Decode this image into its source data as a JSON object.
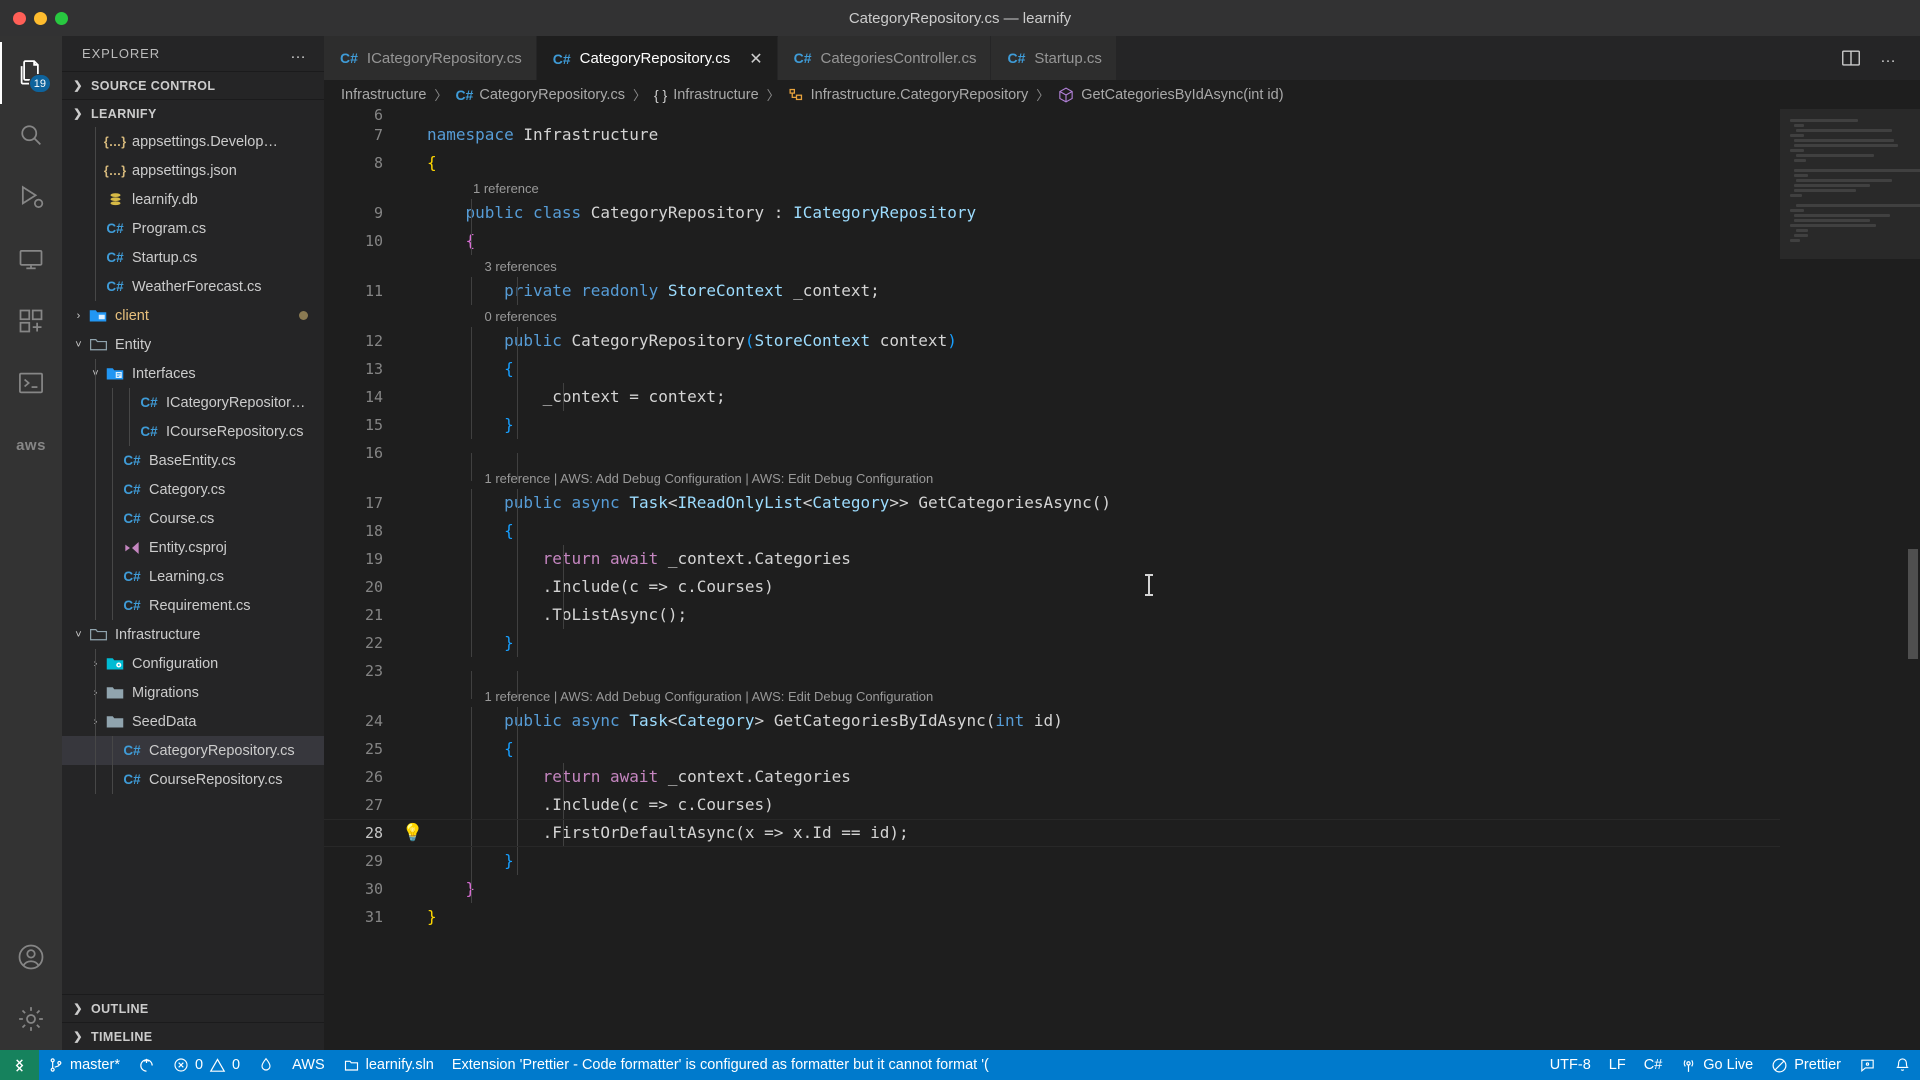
{
  "window": {
    "title": "CategoryRepository.cs — learnify",
    "traffic_lights": [
      "close",
      "minimize",
      "maximize"
    ]
  },
  "activity_bar": {
    "items": [
      {
        "name": "explorer",
        "icon": "files-icon",
        "badge": "19",
        "active": true
      },
      {
        "name": "search",
        "icon": "search-icon",
        "badge": "",
        "active": false
      },
      {
        "name": "run-and-debug",
        "icon": "run-debug-icon",
        "badge": "",
        "active": false
      },
      {
        "name": "remote-explorer",
        "icon": "remote-explorer-icon",
        "badge": "",
        "active": false
      },
      {
        "name": "extensions",
        "icon": "extensions-icon",
        "badge": "",
        "active": false
      },
      {
        "name": "terminal",
        "icon": "terminal-icon",
        "badge": "",
        "active": false
      },
      {
        "name": "aws-toolkit",
        "icon": "aws-icon",
        "badge": "",
        "active": false
      }
    ],
    "bottom_items": [
      {
        "name": "accounts",
        "icon": "account-icon"
      },
      {
        "name": "manage",
        "icon": "gear-icon"
      }
    ],
    "aws_label": "aws"
  },
  "sidebar": {
    "title": "EXPLORER",
    "more_actions": "…",
    "sections": [
      {
        "label": "SOURCE CONTROL",
        "expanded": false
      },
      {
        "label": "LEARNIFY",
        "expanded": true
      }
    ],
    "bottom_sections": [
      {
        "label": "OUTLINE",
        "expanded": false
      },
      {
        "label": "TIMELINE",
        "expanded": false
      }
    ],
    "tree": [
      {
        "label": "appsettings.Develop…",
        "icon": "json-icon",
        "indent": 2,
        "twist": "",
        "selected": false,
        "modified": false
      },
      {
        "label": "appsettings.json",
        "icon": "json-icon",
        "indent": 2,
        "twist": "",
        "selected": false,
        "modified": false
      },
      {
        "label": "learnify.db",
        "icon": "database-icon",
        "indent": 2,
        "twist": "",
        "selected": false,
        "modified": false
      },
      {
        "label": "Program.cs",
        "icon": "csharp-icon",
        "indent": 2,
        "twist": "",
        "selected": false,
        "modified": false
      },
      {
        "label": "Startup.cs",
        "icon": "csharp-icon",
        "indent": 2,
        "twist": "",
        "selected": false,
        "modified": false
      },
      {
        "label": "WeatherForecast.cs",
        "icon": "csharp-icon",
        "indent": 2,
        "twist": "",
        "selected": false,
        "modified": false
      },
      {
        "label": "client",
        "icon": "folder-client-icon",
        "indent": 1,
        "twist": "collapsed",
        "selected": false,
        "modified": true
      },
      {
        "label": "Entity",
        "icon": "folder-open-icon",
        "indent": 1,
        "twist": "expanded",
        "selected": false,
        "modified": false
      },
      {
        "label": "Interfaces",
        "icon": "folder-interfaces-icon",
        "indent": 2,
        "twist": "expanded",
        "selected": false,
        "modified": false
      },
      {
        "label": "ICategoryRepositor…",
        "icon": "csharp-icon",
        "indent": 4,
        "twist": "",
        "selected": false,
        "modified": false
      },
      {
        "label": "ICourseRepository.cs",
        "icon": "csharp-icon",
        "indent": 4,
        "twist": "",
        "selected": false,
        "modified": false
      },
      {
        "label": "BaseEntity.cs",
        "icon": "csharp-icon",
        "indent": 3,
        "twist": "",
        "selected": false,
        "modified": false
      },
      {
        "label": "Category.cs",
        "icon": "csharp-icon",
        "indent": 3,
        "twist": "",
        "selected": false,
        "modified": false
      },
      {
        "label": "Course.cs",
        "icon": "csharp-icon",
        "indent": 3,
        "twist": "",
        "selected": false,
        "modified": false
      },
      {
        "label": "Entity.csproj",
        "icon": "csproj-icon",
        "indent": 3,
        "twist": "",
        "selected": false,
        "modified": false
      },
      {
        "label": "Learning.cs",
        "icon": "csharp-icon",
        "indent": 3,
        "twist": "",
        "selected": false,
        "modified": false
      },
      {
        "label": "Requirement.cs",
        "icon": "csharp-icon",
        "indent": 3,
        "twist": "",
        "selected": false,
        "modified": false
      },
      {
        "label": "Infrastructure",
        "icon": "folder-open-icon",
        "indent": 1,
        "twist": "expanded",
        "selected": false,
        "modified": false
      },
      {
        "label": "Configuration",
        "icon": "folder-config-icon",
        "indent": 2,
        "twist": "collapsed",
        "selected": false,
        "modified": false
      },
      {
        "label": "Migrations",
        "icon": "folder-icon",
        "indent": 2,
        "twist": "collapsed",
        "selected": false,
        "modified": false
      },
      {
        "label": "SeedData",
        "icon": "folder-icon",
        "indent": 2,
        "twist": "collapsed",
        "selected": false,
        "modified": false
      },
      {
        "label": "CategoryRepository.cs",
        "icon": "csharp-icon",
        "indent": 3,
        "twist": "",
        "selected": true,
        "modified": false
      },
      {
        "label": "CourseRepository.cs",
        "icon": "csharp-icon",
        "indent": 3,
        "twist": "",
        "selected": false,
        "modified": false
      }
    ]
  },
  "tabs": [
    {
      "label": "ICategoryRepository.cs",
      "icon": "csharp-icon",
      "active": false,
      "closable": false
    },
    {
      "label": "CategoryRepository.cs",
      "icon": "csharp-icon",
      "active": true,
      "closable": true,
      "close_label": "✕"
    },
    {
      "label": "CategoriesController.cs",
      "icon": "csharp-icon",
      "active": false,
      "closable": false
    },
    {
      "label": "Startup.cs",
      "icon": "csharp-icon",
      "active": false,
      "closable": false
    }
  ],
  "editor_actions": [
    {
      "name": "split-editor",
      "icon": "split-editor-icon"
    },
    {
      "name": "more-actions",
      "icon": "ellipsis-icon",
      "label": "…"
    }
  ],
  "breadcrumbs": [
    {
      "label": "Infrastructure",
      "icon": ""
    },
    {
      "label": "CategoryRepository.cs",
      "icon": "csharp-icon"
    },
    {
      "label": "Infrastructure",
      "icon": "namespace-icon"
    },
    {
      "label": "Infrastructure.CategoryRepository",
      "icon": "class-icon"
    },
    {
      "label": "GetCategoriesByIdAsync(int id)",
      "icon": "method-icon"
    }
  ],
  "code": {
    "partial_top_line": "6",
    "lines": [
      {
        "n": "7",
        "lens": "",
        "indent": 0,
        "html": "<span class='kw'>namespace</span> <span class='plain'>Infrastructure</span>"
      },
      {
        "n": "8",
        "lens": "",
        "indent": 0,
        "html": "<span class='br-yellow'>{</span>"
      },
      {
        "n": "9",
        "lens": "1 reference",
        "lens_indent": 4,
        "indent": 1,
        "html": "    <span class='kw'>public</span> <span class='kw'>class</span> <span class='plain'>CategoryRepository</span> : <span class='var'>ICategoryRepository</span>"
      },
      {
        "n": "10",
        "lens": "",
        "indent": 1,
        "html": "    <span class='br-pink'>{</span>"
      },
      {
        "n": "11",
        "lens": "3 references",
        "lens_indent": 5,
        "indent": 2,
        "html": "        <span class='kw'>private</span> <span class='kw'>readonly</span> <span class='var'>StoreContext</span> <span class='plain'>_context;</span>"
      },
      {
        "n": "12",
        "lens": "0 references",
        "lens_indent": 5,
        "indent": 2,
        "html": "        <span class='kw'>public</span> <span class='plain'>CategoryRepository</span><span class='br-blue'>(</span><span class='var'>StoreContext</span> <span class='plain'>context</span><span class='br-blue'>)</span>"
      },
      {
        "n": "13",
        "lens": "",
        "indent": 2,
        "html": "        <span class='br-blue'>{</span>"
      },
      {
        "n": "14",
        "lens": "",
        "indent": 3,
        "html": "            <span class='plain'>_context = context;</span>"
      },
      {
        "n": "15",
        "lens": "",
        "indent": 2,
        "html": "        <span class='br-blue'>}</span>"
      },
      {
        "n": "16",
        "lens": "",
        "indent": 2,
        "html": ""
      },
      {
        "n": "17",
        "lens": "1 reference | AWS: Add Debug Configuration | AWS: Edit Debug Configuration",
        "lens_indent": 5,
        "indent": 2,
        "html": "        <span class='kw'>public</span> <span class='kw'>async</span> <span class='var'>Task</span>&lt;<span class='var'>IReadOnlyList</span>&lt;<span class='var'>Category</span>&gt;&gt; <span class='plain'>GetCategoriesAsync()</span>"
      },
      {
        "n": "18",
        "lens": "",
        "indent": 2,
        "html": "        <span class='br-blue'>{</span>"
      },
      {
        "n": "19",
        "lens": "",
        "indent": 3,
        "html": "            <span class='kwc'>return</span> <span class='kwc'>await</span> <span class='plain'>_context.Categories</span>"
      },
      {
        "n": "20",
        "lens": "",
        "indent": 3,
        "html": "            <span class='plain'>.Include(c =&gt; c.Courses)</span>"
      },
      {
        "n": "21",
        "lens": "",
        "indent": 3,
        "html": "            <span class='plain'>.ToListAsync();</span>"
      },
      {
        "n": "22",
        "lens": "",
        "indent": 2,
        "html": "        <span class='br-blue'>}</span>"
      },
      {
        "n": "23",
        "lens": "",
        "indent": 2,
        "html": ""
      },
      {
        "n": "24",
        "lens": "1 reference | AWS: Add Debug Configuration | AWS: Edit Debug Configuration",
        "lens_indent": 5,
        "indent": 2,
        "html": "        <span class='kw'>public</span> <span class='kw'>async</span> <span class='var'>Task</span>&lt;<span class='var'>Category</span>&gt; <span class='plain'>GetCategoriesByIdAsync(</span><span class='kw'>int</span> <span class='plain'>id)</span>"
      },
      {
        "n": "25",
        "lens": "",
        "indent": 2,
        "html": "        <span class='br-blue'>{</span>"
      },
      {
        "n": "26",
        "lens": "",
        "indent": 3,
        "html": "            <span class='kwc'>return</span> <span class='kwc'>await</span> <span class='plain'>_context.Categories</span>"
      },
      {
        "n": "27",
        "lens": "",
        "indent": 3,
        "html": "            <span class='plain'>.Include(c =&gt; c.Courses)</span>"
      },
      {
        "n": "28",
        "lens": "",
        "indent": 3,
        "lamp": "💡",
        "current": true,
        "html": "            <span class='plain'>.FirstOrDefaultAsync(x =&gt; x.Id == id);</span>"
      },
      {
        "n": "29",
        "lens": "",
        "indent": 2,
        "html": "        <span class='br-blue'>}</span>"
      },
      {
        "n": "30",
        "lens": "",
        "indent": 1,
        "html": "    <span class='br-pink'>}</span>"
      },
      {
        "n": "31",
        "lens": "",
        "indent": 0,
        "html": "<span class='br-yellow'>}</span>"
      }
    ]
  },
  "status_bar": {
    "remote_icon": "remote-indicator-icon",
    "items": [
      {
        "name": "branch",
        "icon": "source-control-icon",
        "label": "master*"
      },
      {
        "name": "sync-changes",
        "icon": "sync-icon",
        "label": ""
      },
      {
        "name": "problems",
        "icon": "error-warning-icon",
        "label": "0",
        "label2": "0"
      },
      {
        "name": "live-share",
        "icon": "liveshare-icon",
        "label": ""
      },
      {
        "name": "aws-connection",
        "icon": "",
        "label": "AWS"
      },
      {
        "name": "solution",
        "icon": "solution-icon",
        "label": "learnify.sln"
      },
      {
        "name": "notification-message",
        "icon": "",
        "label": "Extension 'Prettier - Code formatter' is configured as formatter but it cannot format '("
      }
    ],
    "right_items": [
      {
        "name": "encoding",
        "icon": "",
        "label": "UTF-8"
      },
      {
        "name": "eol",
        "icon": "",
        "label": "LF"
      },
      {
        "name": "language-mode",
        "icon": "",
        "label": "C#"
      },
      {
        "name": "go-live",
        "icon": "broadcast-icon",
        "label": "Go Live"
      },
      {
        "name": "prettier",
        "icon": "prettier-icon",
        "label": "Prettier"
      },
      {
        "name": "feedback",
        "icon": "feedback-icon",
        "label": ""
      },
      {
        "name": "notifications",
        "icon": "bell-icon",
        "label": ""
      }
    ]
  },
  "colors": {
    "accent": "#007acc",
    "remote_green": "#16825d",
    "editor_bg": "#1e1e1e",
    "sidebar_bg": "#252526",
    "activity_bg": "#333333",
    "badge_blue": "#0e639c"
  }
}
